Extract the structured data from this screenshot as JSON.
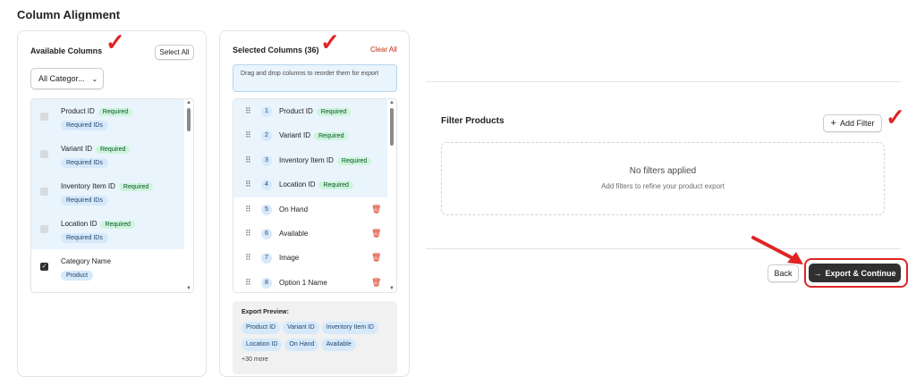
{
  "section_title": "Column Alignment",
  "available": {
    "title": "Available Columns",
    "select_all": "Select All",
    "category_select": "All Categor...",
    "items": [
      {
        "label": "Product ID",
        "badge": "Required",
        "tag": "Required IDs",
        "checked": true,
        "disabled": true
      },
      {
        "label": "Variant ID",
        "badge": "Required",
        "tag": "Required IDs",
        "checked": true,
        "disabled": true
      },
      {
        "label": "Inventory Item ID",
        "badge": "Required",
        "tag": "Required IDs",
        "checked": true,
        "disabled": true
      },
      {
        "label": "Location ID",
        "badge": "Required",
        "tag": "Required IDs",
        "checked": true,
        "disabled": true
      },
      {
        "label": "Category Name",
        "badge": "",
        "tag": "Product",
        "checked": true,
        "disabled": false
      }
    ]
  },
  "selected": {
    "title": "Selected Columns (36)",
    "clear_all": "Clear All",
    "hint": "Drag and drop columns to reorder them for export",
    "items": [
      {
        "num": "1",
        "label": "Product ID",
        "badge": "Required"
      },
      {
        "num": "2",
        "label": "Variant ID",
        "badge": "Required"
      },
      {
        "num": "3",
        "label": "Inventory Item ID",
        "badge": "Required"
      },
      {
        "num": "4",
        "label": "Location ID",
        "badge": "Required"
      },
      {
        "num": "5",
        "label": "On Hand",
        "badge": ""
      },
      {
        "num": "6",
        "label": "Available",
        "badge": ""
      },
      {
        "num": "7",
        "label": "Image",
        "badge": ""
      },
      {
        "num": "8",
        "label": "Option 1 Name",
        "badge": ""
      }
    ],
    "preview_title": "Export Preview:",
    "preview_chips": [
      "Product ID",
      "Variant ID",
      "Inventory Item ID",
      "Location ID",
      "On Hand",
      "Available"
    ],
    "preview_more": "+30 more"
  },
  "filter": {
    "title": "Filter Products",
    "add_filter": "Add Filter",
    "empty_title": "No filters applied",
    "empty_sub": "Add filters to refine your product export"
  },
  "actions": {
    "back": "Back",
    "export": "Export & Continue"
  },
  "colors": {
    "annotation": "#e02424",
    "required_badge": "#cdf5d9",
    "id_tag": "#d6e9fb"
  }
}
